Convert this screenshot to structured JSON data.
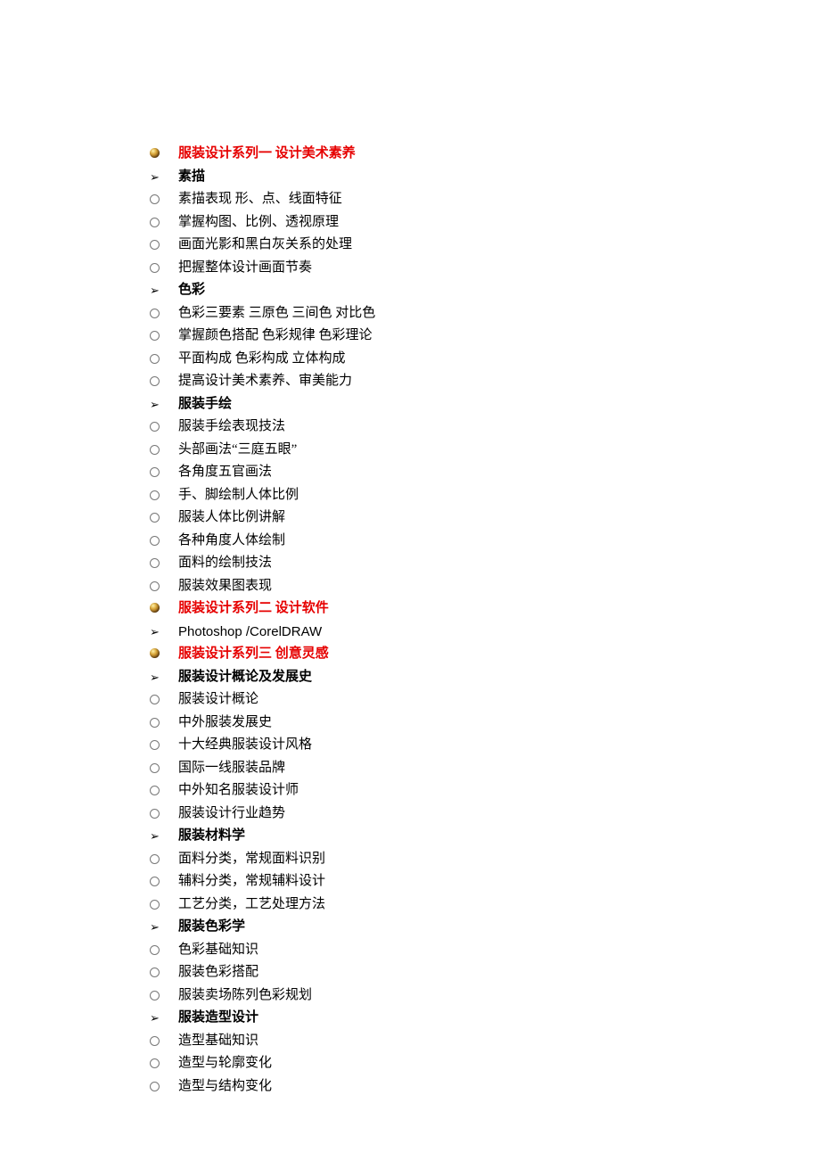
{
  "items": [
    {
      "bullet": "sphere",
      "style": "red-title",
      "text": "服装设计系列一  设计美术素养"
    },
    {
      "bullet": "arrow",
      "style": "bold",
      "text": "素描"
    },
    {
      "bullet": "circle",
      "style": "reg",
      "text": "素描表现 形、点、线面特征"
    },
    {
      "bullet": "circle",
      "style": "reg",
      "text": "掌握构图、比例、透视原理"
    },
    {
      "bullet": "circle",
      "style": "reg",
      "text": "画面光影和黑白灰关系的处理"
    },
    {
      "bullet": "circle",
      "style": "reg",
      "text": "把握整体设计画面节奏"
    },
    {
      "bullet": "arrow",
      "style": "bold",
      "text": "色彩"
    },
    {
      "bullet": "circle",
      "style": "reg",
      "text": "色彩三要素 三原色 三间色 对比色"
    },
    {
      "bullet": "circle",
      "style": "reg",
      "text": "掌握颜色搭配 色彩规律 色彩理论"
    },
    {
      "bullet": "circle",
      "style": "reg",
      "text": "平面构成 色彩构成 立体构成"
    },
    {
      "bullet": "circle",
      "style": "reg",
      "text": "提高设计美术素养、审美能力"
    },
    {
      "bullet": "arrow",
      "style": "bold",
      "text": "服装手绘"
    },
    {
      "bullet": "circle",
      "style": "reg",
      "text": "服装手绘表现技法"
    },
    {
      "bullet": "circle",
      "style": "reg",
      "text": "头部画法“三庭五眼”"
    },
    {
      "bullet": "circle",
      "style": "reg",
      "text": "各角度五官画法"
    },
    {
      "bullet": "circle",
      "style": "reg",
      "text": "手、脚绘制人体比例"
    },
    {
      "bullet": "circle",
      "style": "reg",
      "text": "服装人体比例讲解"
    },
    {
      "bullet": "circle",
      "style": "reg",
      "text": "各种角度人体绘制"
    },
    {
      "bullet": "circle",
      "style": "reg",
      "text": "面料的绘制技法"
    },
    {
      "bullet": "circle",
      "style": "reg",
      "text": "服装效果图表现"
    },
    {
      "bullet": "sphere",
      "style": "red-title",
      "text": "服装设计系列二  设计软件"
    },
    {
      "bullet": "arrow",
      "style": "reg",
      "text": "Photoshop /CorelDRAW",
      "latin": true
    },
    {
      "bullet": "sphere",
      "style": "red-title",
      "text": "服装设计系列三  创意灵感"
    },
    {
      "bullet": "arrow",
      "style": "bold",
      "text": "服装设计概论及发展史"
    },
    {
      "bullet": "circle",
      "style": "reg",
      "text": "服装设计概论"
    },
    {
      "bullet": "circle",
      "style": "reg",
      "text": "中外服装发展史"
    },
    {
      "bullet": "circle",
      "style": "reg",
      "text": "十大经典服装设计风格"
    },
    {
      "bullet": "circle",
      "style": "reg",
      "text": "国际一线服装品牌"
    },
    {
      "bullet": "circle",
      "style": "reg",
      "text": "中外知名服装设计师"
    },
    {
      "bullet": "circle",
      "style": "reg",
      "text": "服装设计行业趋势"
    },
    {
      "bullet": "arrow",
      "style": "bold",
      "text": "服装材料学"
    },
    {
      "bullet": "circle",
      "style": "reg",
      "text": "面料分类，常规面料识别"
    },
    {
      "bullet": "circle",
      "style": "reg",
      "text": "辅料分类，常规辅料设计"
    },
    {
      "bullet": "circle",
      "style": "reg",
      "text": "工艺分类，工艺处理方法"
    },
    {
      "bullet": "arrow",
      "style": "bold",
      "text": "服装色彩学"
    },
    {
      "bullet": "circle",
      "style": "reg",
      "text": "色彩基础知识"
    },
    {
      "bullet": "circle",
      "style": "reg",
      "text": "服装色彩搭配"
    },
    {
      "bullet": "circle",
      "style": "reg",
      "text": "服装卖场陈列色彩规划"
    },
    {
      "bullet": "arrow",
      "style": "bold",
      "text": "服装造型设计"
    },
    {
      "bullet": "circle",
      "style": "reg",
      "text": "造型基础知识"
    },
    {
      "bullet": "circle",
      "style": "reg",
      "text": "造型与轮廓变化"
    },
    {
      "bullet": "circle",
      "style": "reg",
      "text": "造型与结构变化"
    }
  ]
}
